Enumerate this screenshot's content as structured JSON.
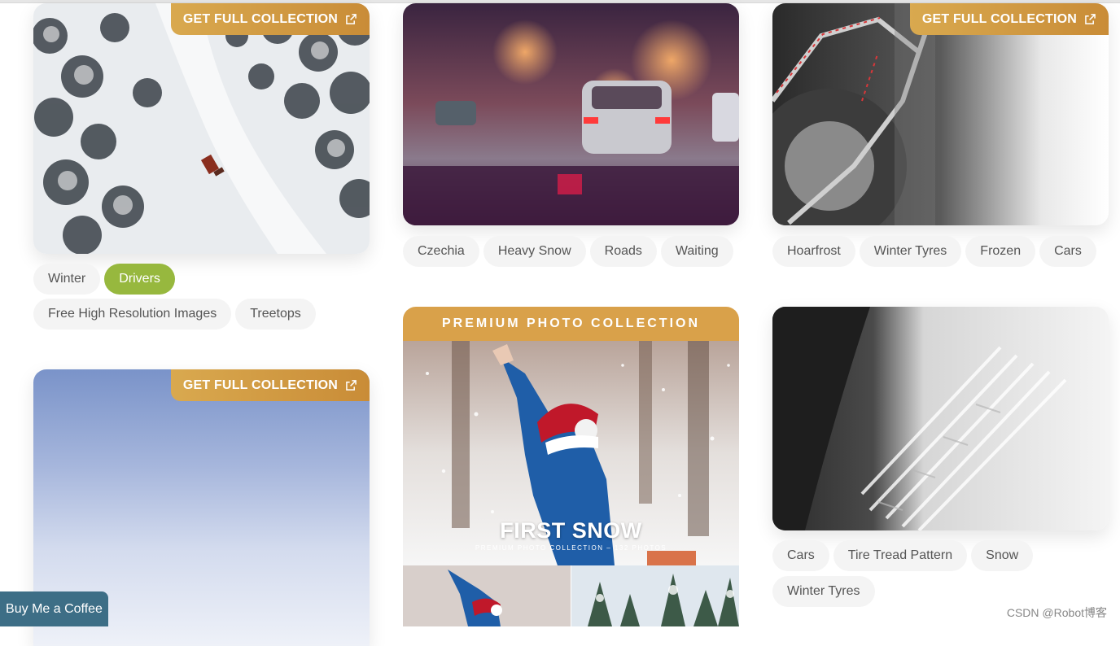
{
  "badges": {
    "get_full_collection": "GET FULL COLLECTION",
    "icon": "external-link-icon"
  },
  "cards": [
    {
      "name": "snowy-forest-aerial",
      "badge": true,
      "tags": [
        "Winter",
        "Drivers",
        "Free High Resolution Images",
        "Treetops"
      ],
      "active_tag": "Drivers"
    },
    {
      "name": "night-snow-traffic",
      "badge": false,
      "tags": [
        "Czechia",
        "Heavy Snow",
        "Roads",
        "Waiting"
      ]
    },
    {
      "name": "snow-chains-wheel",
      "badge": true,
      "tags": [
        "Hoarfrost",
        "Winter Tyres",
        "Frozen",
        "Cars"
      ]
    },
    {
      "name": "blue-sky-gradient",
      "badge": true,
      "tags": []
    },
    {
      "name": "tire-tread-snow",
      "badge": false,
      "tags": [
        "Cars",
        "Tire Tread Pattern",
        "Snow",
        "Winter Tyres"
      ]
    }
  ],
  "premium": {
    "header": "PREMIUM PHOTO COLLECTION",
    "title": "FIRST SNOW",
    "subtitle": "PREMIUM PHOTO COLLECTION – 132 PHOTOS"
  },
  "coffee_button": "Buy Me a Coffee",
  "watermark": "CSDN @Robot博客",
  "colors": {
    "badge_gold": "#d9a94f",
    "active_tag": "#97b83e",
    "coffee": "#3d6e86"
  }
}
